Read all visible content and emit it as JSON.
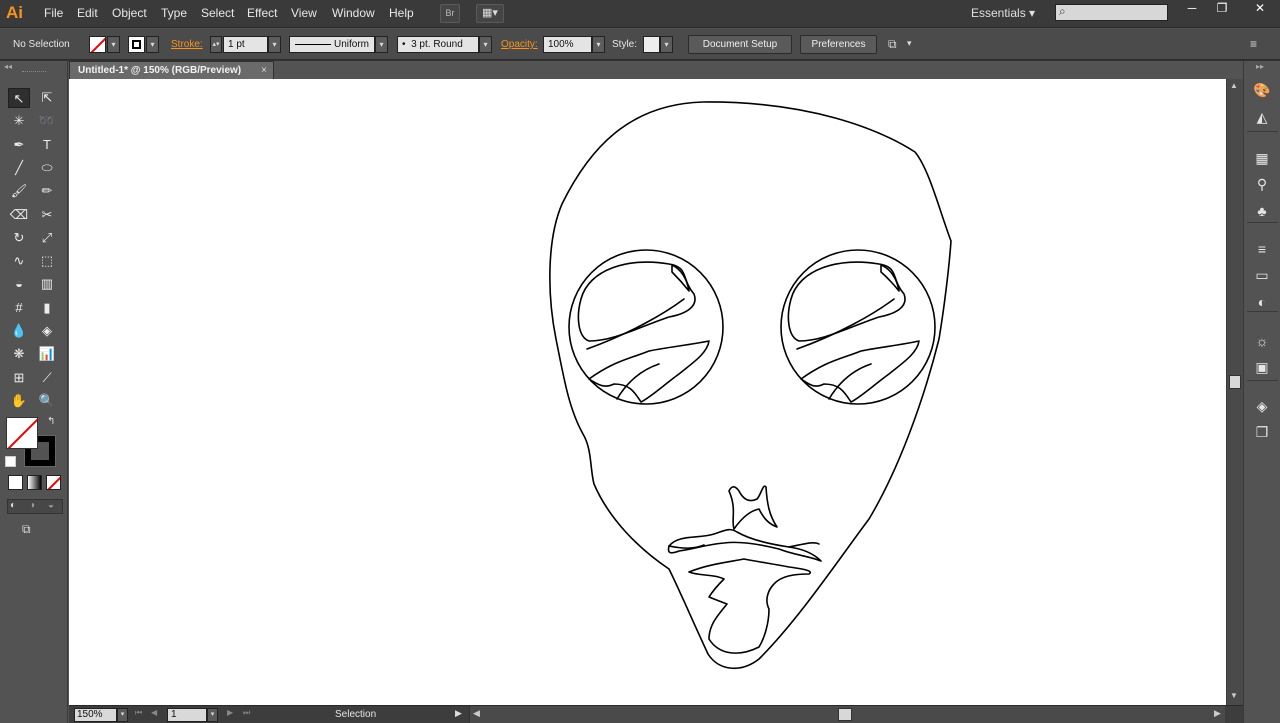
{
  "app": {
    "logo": "Ai"
  },
  "menu": [
    "File",
    "Edit",
    "Object",
    "Type",
    "Select",
    "Effect",
    "View",
    "Window",
    "Help"
  ],
  "menubar_buttons": {
    "bridge": "Br",
    "arrange": "▦▾"
  },
  "workspace": {
    "label": "Essentials",
    "arrow": "▾",
    "search_icon": "⌕"
  },
  "window_controls": {
    "minimize": "─",
    "restore": "❐",
    "close": "✕"
  },
  "control_bar": {
    "selection_status": "No Selection",
    "stroke_label": "Stroke:",
    "stroke_weight": "1 pt",
    "variable_width": "Uniform",
    "brush": "3 pt. Round",
    "opacity_label": "Opacity:",
    "opacity_value": "100%",
    "style_label": "Style:",
    "document_setup": "Document Setup",
    "preferences": "Preferences",
    "drop": "▾",
    "panel_menu": "≡"
  },
  "document": {
    "tab_title": "Untitled-1* @ 150% (RGB/Preview)",
    "close": "×"
  },
  "status": {
    "zoom": "150%",
    "artboard": "1",
    "tool": "Selection",
    "nav_first": "⏮",
    "nav_prev": "◀",
    "nav_next": "▶",
    "nav_last": "⏭"
  },
  "tools": [
    {
      "name": "selection-tool",
      "glyph": "↖"
    },
    {
      "name": "direct-selection-tool",
      "glyph": "⇱"
    },
    {
      "name": "magic-wand-tool",
      "glyph": "✳"
    },
    {
      "name": "lasso-tool",
      "glyph": "➿"
    },
    {
      "name": "pen-tool",
      "glyph": "✒"
    },
    {
      "name": "type-tool",
      "glyph": "T"
    },
    {
      "name": "line-tool",
      "glyph": "╱"
    },
    {
      "name": "ellipse-tool",
      "glyph": "⬭"
    },
    {
      "name": "paintbrush-tool",
      "glyph": "🖌"
    },
    {
      "name": "pencil-tool",
      "glyph": "✏"
    },
    {
      "name": "eraser-tool",
      "glyph": "⌫"
    },
    {
      "name": "scissors-tool",
      "glyph": "✂"
    },
    {
      "name": "rotate-tool",
      "glyph": "↻"
    },
    {
      "name": "scale-tool",
      "glyph": "⤢"
    },
    {
      "name": "warp-tool",
      "glyph": "∿"
    },
    {
      "name": "free-transform-tool",
      "glyph": "⬚"
    },
    {
      "name": "shape-builder-tool",
      "glyph": "◒"
    },
    {
      "name": "perspective-grid-tool",
      "glyph": "▥"
    },
    {
      "name": "mesh-tool",
      "glyph": "#"
    },
    {
      "name": "gradient-tool",
      "glyph": "▮"
    },
    {
      "name": "eyedropper-tool",
      "glyph": "💧"
    },
    {
      "name": "blend-tool",
      "glyph": "◈"
    },
    {
      "name": "symbol-sprayer-tool",
      "glyph": "❋"
    },
    {
      "name": "column-graph-tool",
      "glyph": "📊"
    },
    {
      "name": "artboard-tool",
      "glyph": "⊞"
    },
    {
      "name": "slice-tool",
      "glyph": "⟋"
    },
    {
      "name": "hand-tool",
      "glyph": "✋"
    },
    {
      "name": "zoom-tool",
      "glyph": "🔍"
    }
  ],
  "colors": {
    "menubar": "#3a3a3a",
    "panel": "#535353",
    "accent": "#f7941d",
    "canvas": "#ffffff"
  },
  "dock_icons": [
    "color-guide-icon",
    "color-icon",
    "swatches-icon",
    "brushes-icon",
    "symbols-icon",
    "stroke-icon",
    "gradient-icon",
    "transparency-icon",
    "appearance-icon",
    "graphic-styles-icon",
    "layers-icon",
    "artboards-icon"
  ]
}
